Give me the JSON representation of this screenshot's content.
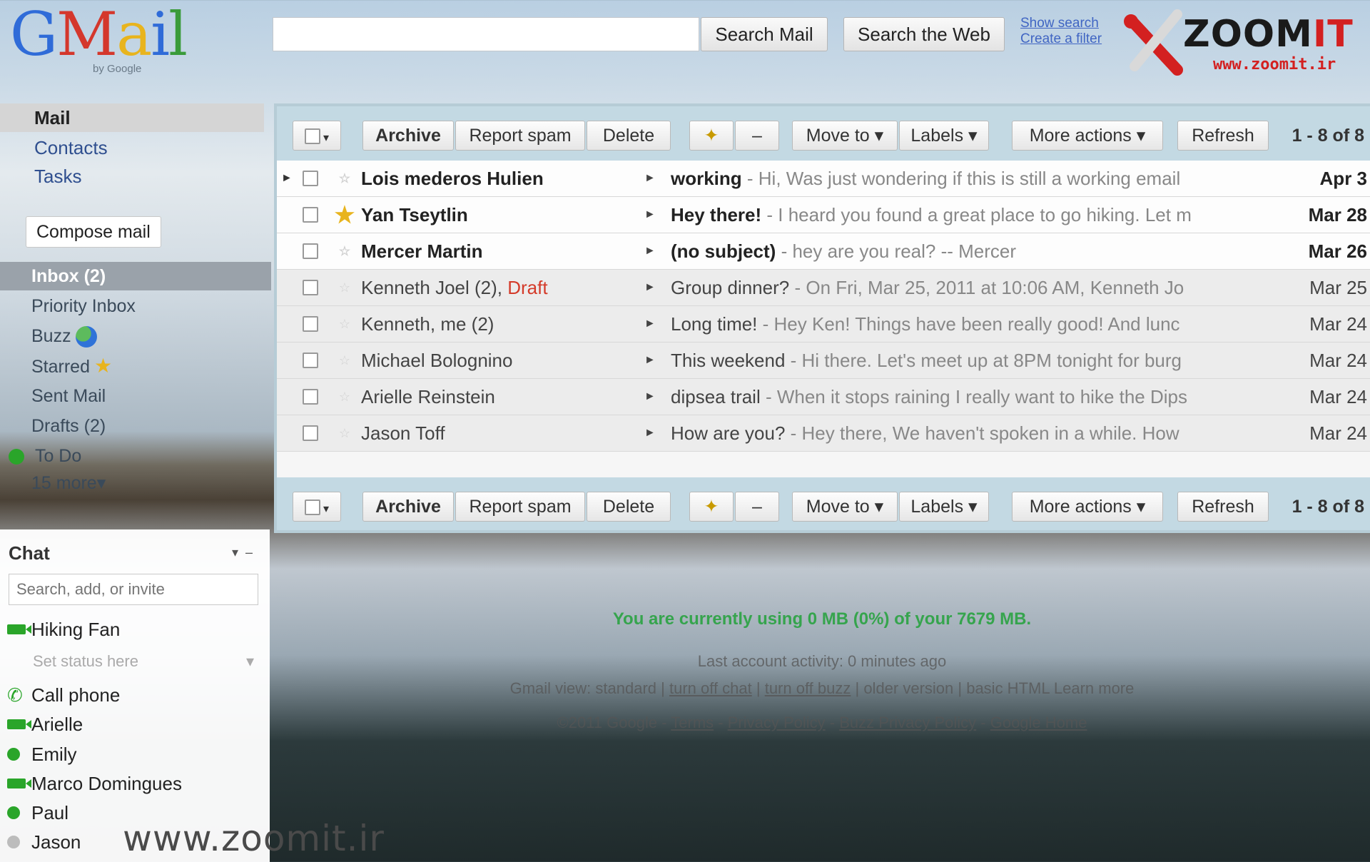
{
  "header": {
    "logo_letters": [
      "G",
      "M",
      "a",
      "i",
      "l"
    ],
    "logo_by": "by Google",
    "search_placeholder": "",
    "search_mail_label": "Search Mail",
    "search_web_label": "Search the Web",
    "show_search_options": "Show search",
    "create_filter": "Create a filter"
  },
  "watermark": {
    "word_prefix": "ZOOM",
    "word_suffix": "IT",
    "url": "www.zoomit.ir",
    "bottom_url": "www.zoomit.ir"
  },
  "nav": {
    "top_links": [
      "Mail",
      "Contacts",
      "Tasks"
    ],
    "compose_label": "Compose mail",
    "folders": {
      "inbox": "Inbox (2)",
      "priority": "Priority Inbox",
      "buzz": "Buzz",
      "starred": "Starred",
      "sent": "Sent Mail",
      "drafts": "Drafts (2)",
      "todo": "To Do",
      "more": "15 more▾"
    }
  },
  "chat": {
    "title": "Chat",
    "search_placeholder": "Search, add, or invite",
    "self_name": "Hiking Fan",
    "set_status": "Set status here",
    "call_phone": "Call phone",
    "contacts": [
      {
        "name": "Arielle",
        "icon": "video-icon"
      },
      {
        "name": "Emily",
        "icon": "available-dot-icon"
      },
      {
        "name": "Marco Domingues",
        "icon": "video-icon"
      },
      {
        "name": "Paul",
        "icon": "available-dot-icon"
      },
      {
        "name": "Jason",
        "icon": "offline-dot-icon"
      }
    ]
  },
  "toolbar": {
    "archive": "Archive",
    "report_spam": "Report spam",
    "delete": "Delete",
    "move_to": "Move to ▾",
    "labels": "Labels ▾",
    "more_actions": "More actions ▾",
    "refresh": "Refresh",
    "count": "1 - 8 of 8"
  },
  "messages": [
    {
      "sender": "Lois mederos Hulien",
      "draft": "",
      "subject": "working",
      "snippet": " - Hi, Was just wondering if this is still a working email",
      "date": "Apr 3",
      "unread": true,
      "starred": false
    },
    {
      "sender": "Yan Tseytlin",
      "draft": "",
      "subject": "Hey there!",
      "snippet": " - I heard you found a great place to go hiking. Let m",
      "date": "Mar 28",
      "unread": true,
      "starred": true
    },
    {
      "sender": "Mercer Martin",
      "draft": "",
      "subject": "(no subject)",
      "snippet": " - hey are you real? -- Mercer",
      "date": "Mar 26",
      "unread": true,
      "starred": false
    },
    {
      "sender": "Kenneth Joel (2), ",
      "draft": "Draft",
      "subject": "Group dinner?",
      "snippet": " - On Fri, Mar 25, 2011 at 10:06 AM, Kenneth Jo",
      "date": "Mar 25",
      "unread": false,
      "starred": false
    },
    {
      "sender": "Kenneth, me (2)",
      "draft": "",
      "subject": "Long time!",
      "snippet": " - Hey Ken! Things have been really good! And lunc",
      "date": "Mar 24",
      "unread": false,
      "starred": false
    },
    {
      "sender": "Michael Bolognino",
      "draft": "",
      "subject": "This weekend",
      "snippet": " - Hi there. Let's meet up at 8PM tonight for burg",
      "date": "Mar 24",
      "unread": false,
      "starred": false
    },
    {
      "sender": "Arielle Reinstein",
      "draft": "",
      "subject": "dipsea trail",
      "snippet": " - When it stops raining I really want to hike the Dips",
      "date": "Mar 24",
      "unread": false,
      "starred": false
    },
    {
      "sender": "Jason Toff",
      "draft": "",
      "subject": "How are you?",
      "snippet": " - Hey there, We haven't spoken in a while. How",
      "date": "Mar 24",
      "unread": false,
      "starred": false
    }
  ],
  "footer": {
    "usage": "You are currently using 0 MB (0%) of your 7679 MB.",
    "activity": "Last account activity: 0 minutes ago",
    "view_prefix": "Gmail view: standard | ",
    "turn_off_chat": "turn off chat",
    "turn_off_buzz": "turn off buzz",
    "view_suffix": " | older version | basic HTML  Learn more",
    "copyright": "©2011 Google - ",
    "terms": "Terms",
    "privacy": "Privacy Policy",
    "buzz_privacy": "Buzz Privacy Policy",
    "google_home": "Google Home"
  },
  "colors": {
    "accent_green": "#22a23a",
    "draft_red": "#d43b2a",
    "star_yellow": "#e8b41e",
    "link_blue": "#2a52be"
  }
}
